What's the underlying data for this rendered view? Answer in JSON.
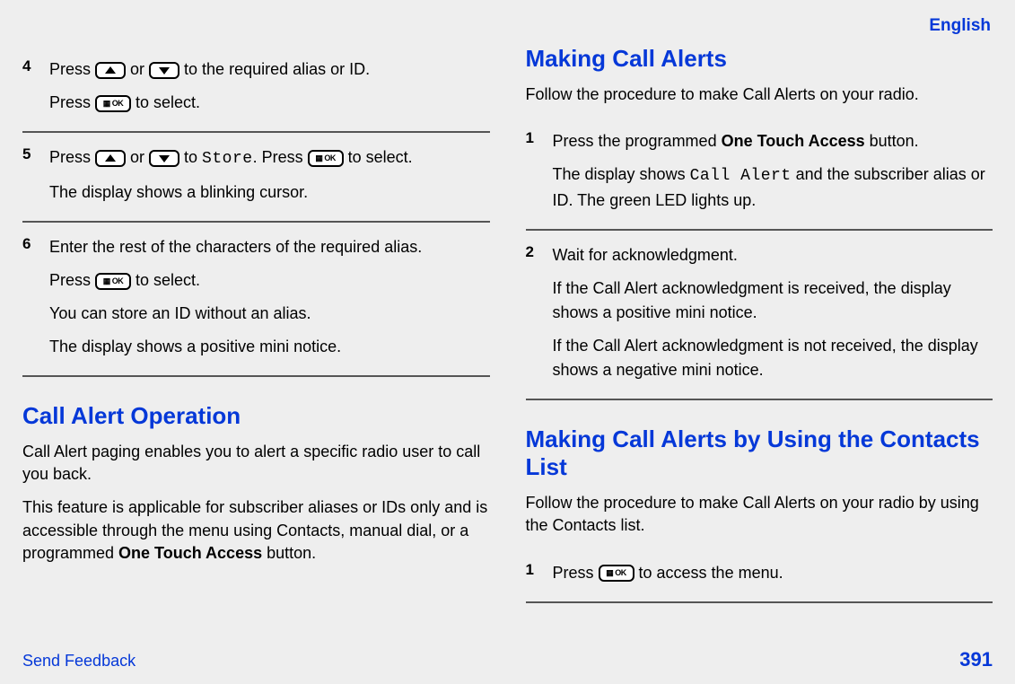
{
  "header": {
    "language": "English"
  },
  "left": {
    "steps": [
      {
        "num": "4",
        "lines": [
          [
            {
              "t": "text",
              "v": "Press "
            },
            {
              "t": "up"
            },
            {
              "t": "text",
              "v": " or "
            },
            {
              "t": "down"
            },
            {
              "t": "text",
              "v": " to the required alias or ID."
            }
          ],
          [
            {
              "t": "text",
              "v": "Press "
            },
            {
              "t": "ok"
            },
            {
              "t": "text",
              "v": " to select."
            }
          ]
        ]
      },
      {
        "num": "5",
        "lines": [
          [
            {
              "t": "text",
              "v": "Press "
            },
            {
              "t": "up"
            },
            {
              "t": "text",
              "v": " or "
            },
            {
              "t": "down"
            },
            {
              "t": "text",
              "v": " to "
            },
            {
              "t": "mono",
              "v": "Store"
            },
            {
              "t": "text",
              "v": ". Press "
            },
            {
              "t": "ok"
            },
            {
              "t": "text",
              "v": " to select."
            }
          ],
          [
            {
              "t": "text",
              "v": "The display shows a blinking cursor."
            }
          ]
        ]
      },
      {
        "num": "6",
        "lines": [
          [
            {
              "t": "text",
              "v": "Enter the rest of the characters of the required alias."
            }
          ],
          [
            {
              "t": "text",
              "v": "Press "
            },
            {
              "t": "ok"
            },
            {
              "t": "text",
              "v": " to select."
            }
          ],
          [
            {
              "t": "text",
              "v": "You can store an ID without an alias."
            }
          ],
          [
            {
              "t": "text",
              "v": "The display shows a positive mini notice."
            }
          ]
        ]
      }
    ],
    "h2": "Call Alert Operation",
    "p1": "Call Alert paging enables you to alert a specific radio user to call you back.",
    "p2_pre": "This feature is applicable for subscriber aliases or IDs only and is accessible through the menu using Contacts, manual dial, or a programmed ",
    "p2_bold": "One Touch Access",
    "p2_post": " button."
  },
  "right": {
    "h2a": "Making Call Alerts",
    "p1": "Follow the procedure to make Call Alerts on your radio.",
    "stepsA": [
      {
        "num": "1",
        "lines": [
          [
            {
              "t": "text",
              "v": "Press the programmed "
            },
            {
              "t": "bold",
              "v": "One Touch Access"
            },
            {
              "t": "text",
              "v": " button."
            }
          ],
          [
            {
              "t": "text",
              "v": "The display shows "
            },
            {
              "t": "mono",
              "v": "Call Alert"
            },
            {
              "t": "text",
              "v": " and the subscriber alias or ID. The green LED lights up."
            }
          ]
        ]
      },
      {
        "num": "2",
        "lines": [
          [
            {
              "t": "text",
              "v": "Wait for acknowledgment."
            }
          ],
          [
            {
              "t": "text",
              "v": "If the Call Alert acknowledgment is received, the display shows a positive mini notice."
            }
          ],
          [
            {
              "t": "text",
              "v": "If the Call Alert acknowledgment is not received, the display shows a negative mini notice."
            }
          ]
        ]
      }
    ],
    "h2b": "Making Call Alerts by Using the Contacts List",
    "p2": "Follow the procedure to make Call Alerts on your radio by using the Contacts list.",
    "stepsB": [
      {
        "num": "1",
        "lines": [
          [
            {
              "t": "text",
              "v": "Press "
            },
            {
              "t": "ok"
            },
            {
              "t": "text",
              "v": " to access the menu."
            }
          ]
        ]
      }
    ]
  },
  "footer": {
    "feedback": "Send Feedback",
    "page": "391"
  },
  "ok_label": "▦ OK"
}
